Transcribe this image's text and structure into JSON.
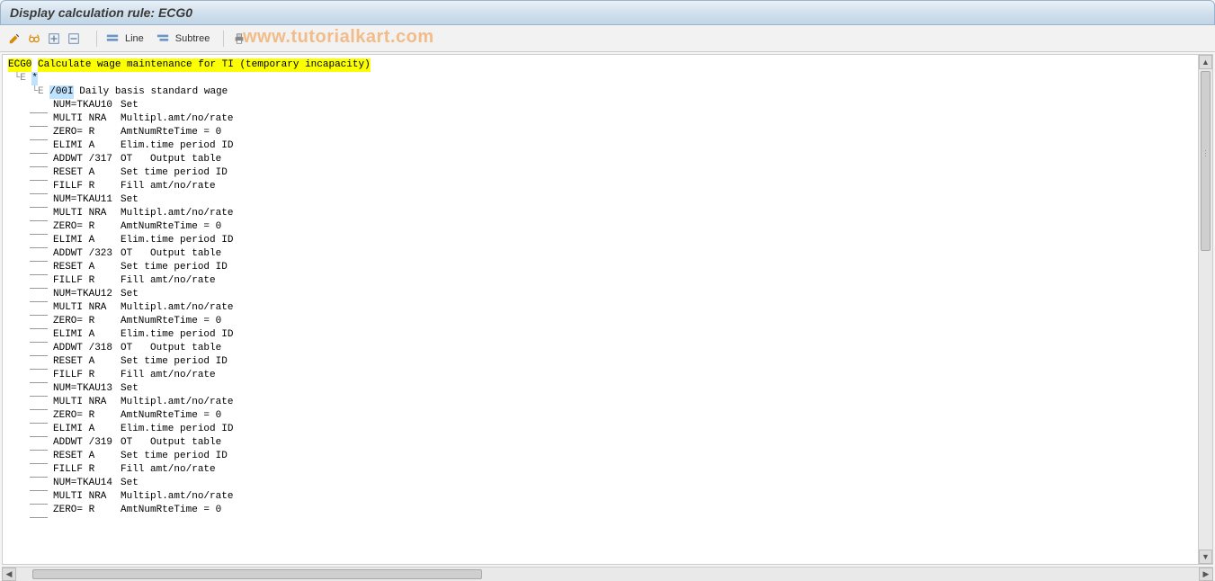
{
  "title": "Display calculation rule: ECG0",
  "watermark": "www.tutorialkart.com",
  "toolbar": {
    "line_label": "Line",
    "subtree_label": "Subtree"
  },
  "tree": {
    "root_code": "ECG0",
    "root_desc": "Calculate wage maintenance for TI (temporary incapacity)",
    "level1_label": "*",
    "level2_code": "/00I",
    "level2_desc": "Daily basis standard wage",
    "leaves": [
      {
        "op": "NUM=TKAU10",
        "desc": "Set"
      },
      {
        "op": "MULTI NRA",
        "desc": "Multipl.amt/no/rate"
      },
      {
        "op": "ZERO= R",
        "desc": "AmtNumRteTime = 0"
      },
      {
        "op": "ELIMI A",
        "desc": "Elim.time period ID"
      },
      {
        "op": "ADDWT /317",
        "desc": "OT   Output table"
      },
      {
        "op": "RESET A",
        "desc": "Set time period ID"
      },
      {
        "op": "FILLF R",
        "desc": "Fill amt/no/rate"
      },
      {
        "op": "NUM=TKAU11",
        "desc": "Set"
      },
      {
        "op": "MULTI NRA",
        "desc": "Multipl.amt/no/rate"
      },
      {
        "op": "ZERO= R",
        "desc": "AmtNumRteTime = 0"
      },
      {
        "op": "ELIMI A",
        "desc": "Elim.time period ID"
      },
      {
        "op": "ADDWT /323",
        "desc": "OT   Output table"
      },
      {
        "op": "RESET A",
        "desc": "Set time period ID"
      },
      {
        "op": "FILLF R",
        "desc": "Fill amt/no/rate"
      },
      {
        "op": "NUM=TKAU12",
        "desc": "Set"
      },
      {
        "op": "MULTI NRA",
        "desc": "Multipl.amt/no/rate"
      },
      {
        "op": "ZERO= R",
        "desc": "AmtNumRteTime = 0"
      },
      {
        "op": "ELIMI A",
        "desc": "Elim.time period ID"
      },
      {
        "op": "ADDWT /318",
        "desc": "OT   Output table"
      },
      {
        "op": "RESET A",
        "desc": "Set time period ID"
      },
      {
        "op": "FILLF R",
        "desc": "Fill amt/no/rate"
      },
      {
        "op": "NUM=TKAU13",
        "desc": "Set"
      },
      {
        "op": "MULTI NRA",
        "desc": "Multipl.amt/no/rate"
      },
      {
        "op": "ZERO= R",
        "desc": "AmtNumRteTime = 0"
      },
      {
        "op": "ELIMI A",
        "desc": "Elim.time period ID"
      },
      {
        "op": "ADDWT /319",
        "desc": "OT   Output table"
      },
      {
        "op": "RESET A",
        "desc": "Set time period ID"
      },
      {
        "op": "FILLF R",
        "desc": "Fill amt/no/rate"
      },
      {
        "op": "NUM=TKAU14",
        "desc": "Set"
      },
      {
        "op": "MULTI NRA",
        "desc": "Multipl.amt/no/rate"
      },
      {
        "op": "ZERO= R",
        "desc": "AmtNumRteTime = 0"
      }
    ]
  }
}
